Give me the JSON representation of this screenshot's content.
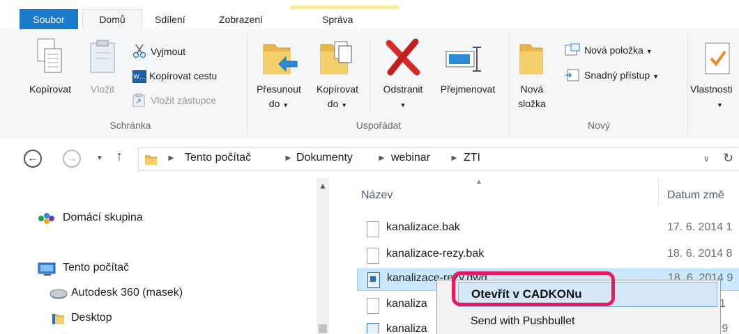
{
  "tabs": {
    "file": "Soubor",
    "home": "Domů",
    "share": "Sdílení",
    "view": "Zobrazení",
    "manage": "Správa"
  },
  "ribbon": {
    "clipboard": {
      "group_label": "Schránka",
      "copy": "Kopírovat",
      "paste": "Vložit",
      "cut": "Vyjmout",
      "copy_path": "Kopírovat cestu",
      "paste_shortcut": "Vložit zástupce"
    },
    "organize": {
      "group_label": "Uspořádat",
      "move_to_line1": "Přesunout",
      "move_to_line2": "do",
      "copy_to_line1": "Kopírovat",
      "copy_to_line2": "do",
      "delete": "Odstranit",
      "rename": "Přejmenovat"
    },
    "new": {
      "group_label": "Nový",
      "new_folder_line1": "Nová",
      "new_folder_line2": "složka",
      "new_item": "Nová položka",
      "easy_access": "Snadný přístup"
    },
    "open": {
      "properties": "Vlastnosti"
    }
  },
  "address": {
    "crumbs": [
      "Tento počítač",
      "Dokumenty",
      "webinar",
      "ZTI"
    ]
  },
  "nav": {
    "homegroup": "Domácí skupina",
    "this_pc": "Tento počítač",
    "autodesk": "Autodesk 360 (masek)",
    "desktop": "Desktop"
  },
  "filelist": {
    "col_name": "Název",
    "col_date": "Datum změ",
    "rows": [
      {
        "name": "kanalizace.bak",
        "date": "17. 6. 2014 1"
      },
      {
        "name": "kanalizace-rezy.bak",
        "date": "18. 6. 2014 8"
      },
      {
        "name": "kanalizace-rezy.dwg",
        "date": "18. 6. 2014 9"
      },
      {
        "name": "kanaliza",
        "date": "1"
      },
      {
        "name": "kanaliza",
        "date": "4 9"
      }
    ]
  },
  "context_menu": {
    "open_in_cadkon": "Otevřít v CADKONu",
    "send_pushbullet": "Send with Pushbullet"
  },
  "colors": {
    "accent_blue": "#1979ca",
    "highlight_pink": "#e8195c",
    "selection_blue": "#cce8ff"
  }
}
